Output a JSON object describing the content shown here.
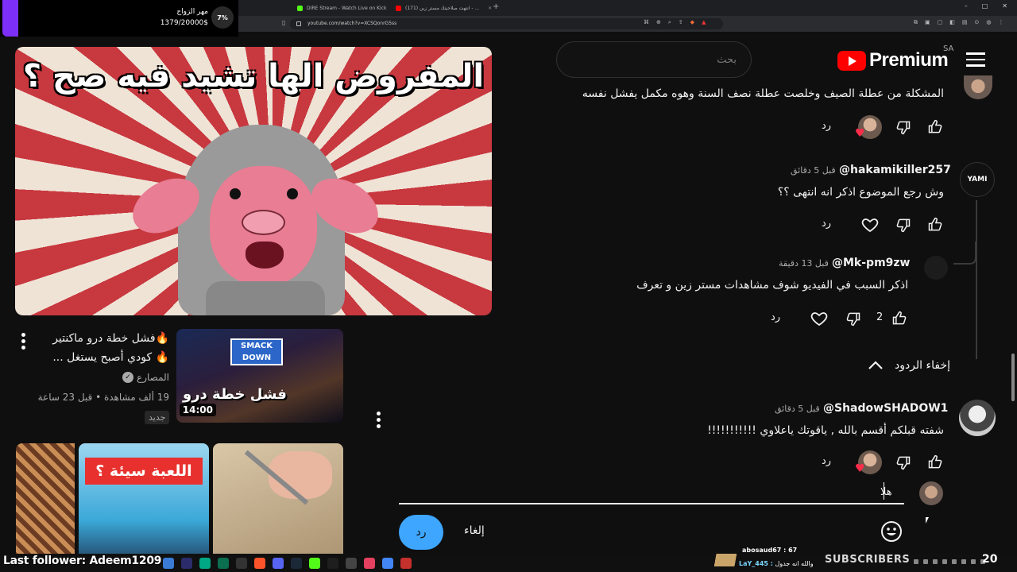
{
  "browser": {
    "tabs": [
      {
        "label": "DIRE Stream - Watch Live on Kick",
        "color": "#53fc18"
      },
      {
        "label": "(171) انتهت صلاحيتك مستر زين - ...",
        "color": "#ff0000"
      }
    ],
    "url": "youtube.com/watch?v=XCSQonrG5ss"
  },
  "donation": {
    "title": "مهر الزواج",
    "amount": "1379/20000$",
    "percent": "7%"
  },
  "header": {
    "search_placeholder": "بحث",
    "logo_text": "Premium",
    "region": "SA"
  },
  "video": {
    "overlay_text": "المفروض الها تشيد فيه صح ؟"
  },
  "suggested": {
    "title": "🔥فشل خطة درو ماكنتير 🔥 كودي أصبح يستغل ...",
    "channel": "المصارع",
    "meta": "19 ألف مشاهدة • قبل 23 ساعة",
    "badge": "جديد",
    "duration": "14:00",
    "thumb_logo": "SMACK DOWN",
    "thumb_text": "فشل خطة درو",
    "thumb3_label": "اللعبة سيئة ؟"
  },
  "comments": [
    {
      "text": "المشكلة من عطلة الصيف وخلصت عطلة نصف السنة وهوه مكمل يفشل نفسه",
      "reply_label": "رد"
    },
    {
      "handle": "@hakamikiller257",
      "time": "قبل 5 دقائق",
      "text": "وش رجع الموضوع اذكر انه انتهى ؟؟",
      "reply_label": "رد",
      "avatar_text": "YAMI"
    },
    {
      "handle": "@Mk-pm9zw",
      "time": "قبل 13 دقيقة",
      "text": "اذكر السبب في الفيديو شوف مشاهدات مستر زين و تعرف",
      "likes": "2",
      "reply_label": "رد"
    },
    {
      "handle": "@ShadowSHADOW1",
      "time": "قبل 5 دقائق",
      "text": "شفته قبلكم أقسم بالله , ياقوتك ياعلاوي !!!!!!!!!!!",
      "reply_label": "رد"
    }
  ],
  "hide_replies": "إخفاء الردود",
  "composer": {
    "value": "هلا",
    "reply_button": "رد",
    "cancel_button": "إلغاء"
  },
  "overlay_bottom": {
    "follower": "Last follower: Adeem1209",
    "chat_line1": "abosaud67 : 67",
    "chat_user2": "LaY_445 :",
    "chat_line2": "والله انه جدول",
    "subscribers": "SUBSCRIBERS",
    "sub_count": "20"
  }
}
